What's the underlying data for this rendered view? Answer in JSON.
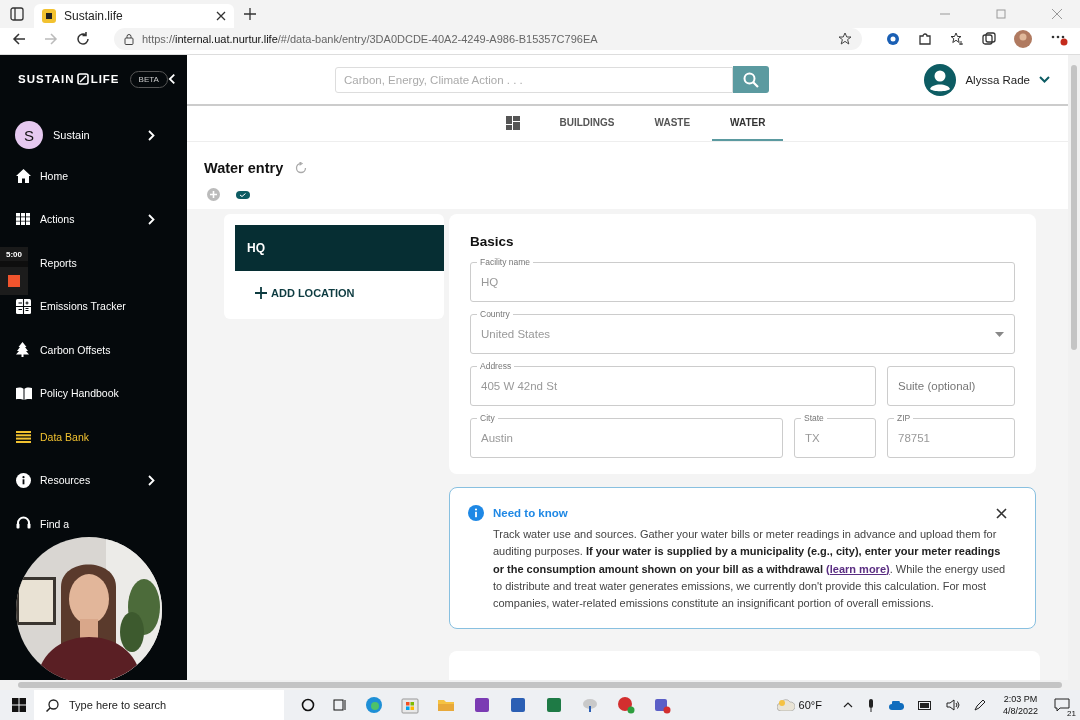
{
  "browser": {
    "tab_title": "Sustain.life",
    "url_scheme": "https://",
    "url_host": "internal.uat.nurtur.life",
    "url_path": "/#/data-bank/entry/3DA0DCDE-40A2-4249-A986-B15357C796EA"
  },
  "sidebar": {
    "logo_left": "SUSTAIN",
    "logo_right": "LIFE",
    "badge": "BETA",
    "profile": {
      "initial": "S",
      "name": "Sustain"
    },
    "items": [
      {
        "kind": "home",
        "label": "Home",
        "selected": false,
        "submenu": false
      },
      {
        "kind": "grid",
        "label": "Actions",
        "selected": false,
        "submenu": true
      },
      {
        "kind": "hidden",
        "label": "Reports",
        "selected": false,
        "submenu": false
      },
      {
        "kind": "calculator",
        "label": "Emissions Tracker",
        "selected": false,
        "submenu": false
      },
      {
        "kind": "tree",
        "label": "Carbon Offsets",
        "selected": false,
        "submenu": false
      },
      {
        "kind": "book",
        "label": "Policy Handbook",
        "selected": false,
        "submenu": false
      },
      {
        "kind": "list",
        "label": "Data Bank",
        "selected": true,
        "submenu": false
      },
      {
        "kind": "info",
        "label": "Resources",
        "selected": false,
        "submenu": true
      },
      {
        "kind": "headset",
        "label": "Find a",
        "selected": false,
        "submenu": false
      }
    ]
  },
  "recorder": {
    "timer": "5:00"
  },
  "header": {
    "search_placeholder": "Carbon, Energy, Climate Action . . .",
    "user_name": "Alyssa Rade"
  },
  "tabs": [
    {
      "kind": "icon",
      "selected": false
    },
    {
      "kind": "text",
      "label": "BUILDINGS",
      "selected": false
    },
    {
      "kind": "text",
      "label": "WASTE",
      "selected": false
    },
    {
      "kind": "text",
      "label": "WATER",
      "selected": true
    }
  ],
  "page": {
    "title": "Water entry"
  },
  "locations": [
    {
      "name": "HQ",
      "selected": true
    }
  ],
  "add_location": "ADD LOCATION",
  "basics": {
    "title": "Basics",
    "fields": [
      {
        "kind": "text",
        "label": "Facility name",
        "value": "HQ"
      },
      {
        "kind": "select",
        "label": "Country",
        "value": "United States"
      },
      {
        "kind": "text",
        "label": "Address",
        "value": "405 W 42nd St"
      },
      {
        "kind": "text",
        "placeholder": "Suite (optional)"
      },
      {
        "kind": "text",
        "label": "City",
        "value": "Austin"
      },
      {
        "kind": "text",
        "label": "State",
        "value": "TX"
      },
      {
        "kind": "text",
        "label": "ZIP",
        "value": "78751"
      }
    ]
  },
  "notice": {
    "title": "Need to know",
    "text": "Track water use and sources. Gather your water bills or meter readings in advance and upload them for auditing purposes. **If your water is supplied by a municipality (e.g., city), enter your meter readings or the consumption amount shown on your bill as a withdrawal** ",
    "link": "(learn more)",
    "text_after": ". While the energy used to distribute and treat water generates emissions, we currently don't provide this calculation. For most companies, water-related emissions constitute an insignificant portion of overall emissions."
  },
  "taskbar": {
    "search_placeholder": "Type here to search",
    "weather": "60°F",
    "time": "2:03 PM",
    "date": "4/8/2022",
    "notifications": "21"
  }
}
